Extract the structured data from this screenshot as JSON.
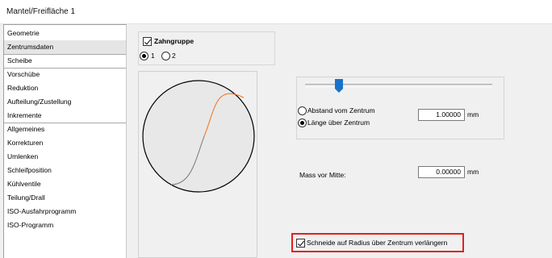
{
  "window": {
    "title": "Mantel/Freifläche 1"
  },
  "sidebar": {
    "items": [
      {
        "label": "Geometrie"
      },
      {
        "label": "Zentrumsdaten",
        "selected": true
      },
      {
        "label": "Scheibe"
      },
      {
        "label": "Vorschübe"
      },
      {
        "label": "Reduktion"
      },
      {
        "label": "Aufteilung/Zustellung"
      },
      {
        "label": "Inkremente"
      },
      {
        "label": "Allgemeines"
      },
      {
        "label": "Korrekturen"
      },
      {
        "label": "Umlenken"
      },
      {
        "label": "Schleifposition"
      },
      {
        "label": "Kühlventile"
      },
      {
        "label": "Teilung/Drall"
      },
      {
        "label": "ISO-Ausfahrprogramm"
      },
      {
        "label": "ISO-Programm"
      }
    ]
  },
  "zahngruppe": {
    "label": "Zahngruppe",
    "checked": true,
    "options": [
      {
        "label": "1",
        "selected": true
      },
      {
        "label": "2",
        "selected": false
      }
    ]
  },
  "position": {
    "slider_level": 0.18,
    "option_abstand": "Abstand vom Zentrum",
    "option_laenge": "Länge über Zentrum",
    "value": "1.00000",
    "unit": "mm"
  },
  "mass": {
    "label": "Mass vor Mitte:",
    "value": "0.00000",
    "unit": "mm"
  },
  "schneide": {
    "label": "Schneide auf Radius über Zentrum verlängern",
    "checked": true
  },
  "colors": {
    "accent": "#1a73c8",
    "highlight": "#e02020",
    "edge_orange": "#f07020"
  }
}
